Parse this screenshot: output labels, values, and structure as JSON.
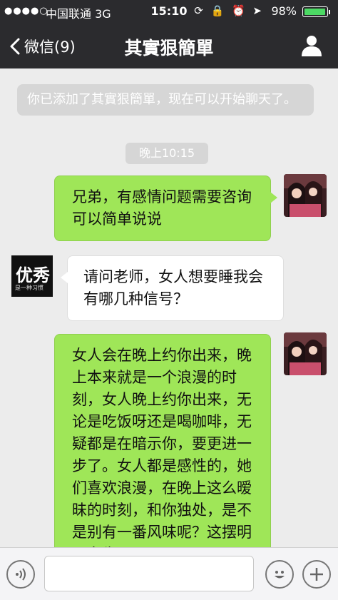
{
  "status_bar": {
    "signal": "●●●●○",
    "carrier": "中国联通  3G",
    "time": "15:10",
    "icons": "⟳ 🔒 ⏰ ➤",
    "battery": "98%",
    "battery_level": 0.98
  },
  "nav": {
    "back_label": "微信(9)",
    "title": "其實狠簡單"
  },
  "messages": {
    "system": "你已添加了其實狠簡單，现在可以开始聊天了。",
    "timestamp": "晚上10:15",
    "m1": "兄弟，有感情问题需要咨询可以简单说说",
    "m2": "请问老师，女人想要睡我会有哪几种信号？",
    "m3": "女人会在晚上约你出来，晚上本来就是一个浪漫的时刻，女人晚上约你出来，无论是吃饭呀还是喝咖啡，无疑都是在暗示你，要更进一步了。女人都是感性的，她们喜欢浪漫，在晚上这么暧昧的时刻，和你独处，是不是别有一番风味呢？这摆明了女生"
  },
  "contact_avatar": {
    "big_text": "优秀",
    "small_text": "是一种习惯"
  },
  "input": {
    "value": ""
  },
  "colors": {
    "nav_bg": "#2b2b2e",
    "sent_bubble": "#9fe658",
    "received_bubble": "#ffffff",
    "chat_bg": "#ececec"
  }
}
